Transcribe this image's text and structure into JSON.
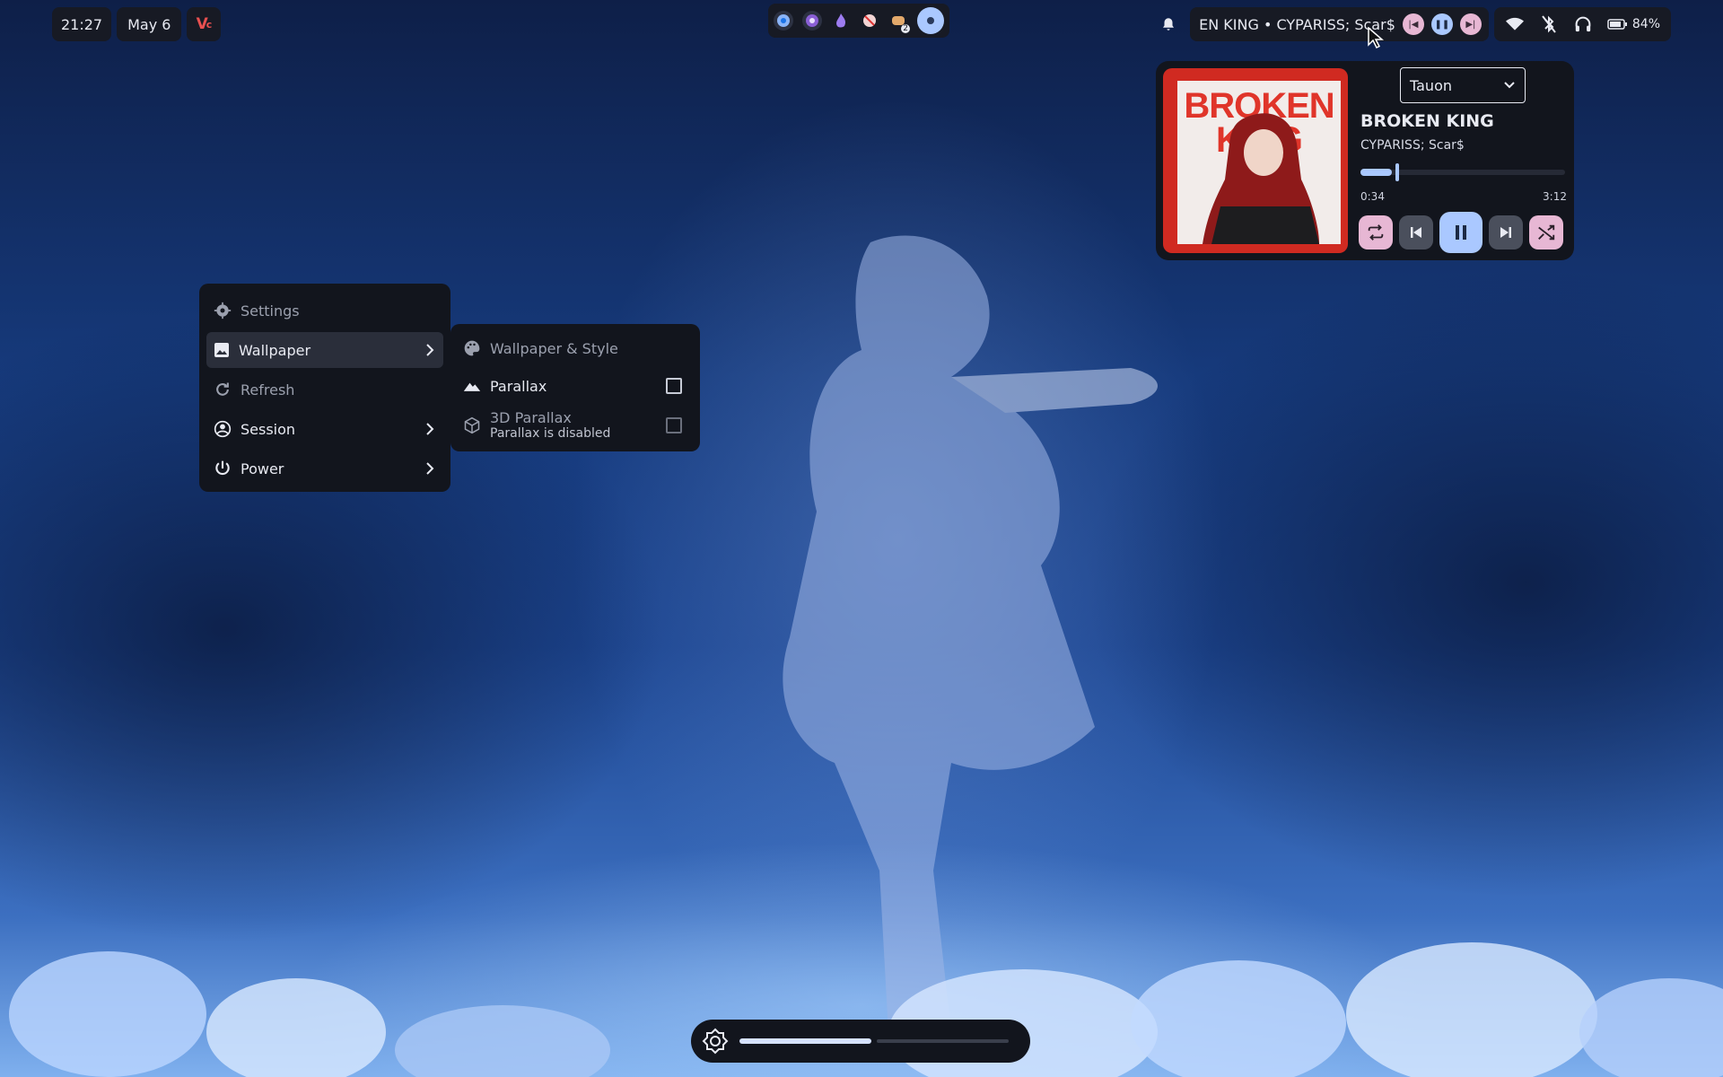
{
  "topbar": {
    "time": "21:27",
    "date": "May 6",
    "logo_text": "V",
    "workspaces": [
      {
        "icon": "chromium-icon"
      },
      {
        "icon": "obs-icon"
      },
      {
        "icon": "app-icon"
      },
      {
        "icon": "muted-app-icon"
      },
      {
        "icon": "discord-icon",
        "badge": "2"
      },
      {
        "icon": "active-dot-icon"
      }
    ],
    "media_text": "EN KING • CYPARISS; Scar$",
    "battery": "84%"
  },
  "media_player": {
    "player_name": "Tauon",
    "title": "BROKEN KING",
    "artist": "CYPARISS; Scar$",
    "cover_text_top": "BROKEN",
    "cover_text_bottom": "KING",
    "elapsed": "0:34",
    "total": "3:12",
    "progress_fraction": 0.18
  },
  "context_menu": {
    "items": [
      {
        "label": "Settings"
      },
      {
        "label": "Wallpaper"
      },
      {
        "label": "Refresh"
      },
      {
        "label": "Session"
      },
      {
        "label": "Power"
      }
    ]
  },
  "wallpaper_submenu": {
    "header": "Wallpaper & Style",
    "parallax": "Parallax",
    "parallax_3d": "3D Parallax",
    "parallax_3d_note": "Parallax is disabled"
  },
  "osd": {
    "brightness_fraction": 0.49
  },
  "colors": {
    "accent": "#aac8ff",
    "pink": "#e7b7d4",
    "panel": "#12151d"
  }
}
